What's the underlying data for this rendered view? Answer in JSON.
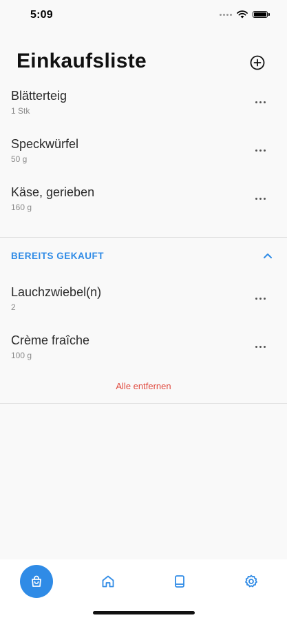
{
  "status_bar": {
    "time": "5:09",
    "icons": [
      "cellular-signal-icon",
      "wifi-icon",
      "battery-icon"
    ]
  },
  "header": {
    "title": "Einkaufsliste",
    "add_icon": "plus-circle-icon"
  },
  "shopping_list": [
    {
      "name": "Blätterteig",
      "quantity": "1 Stk"
    },
    {
      "name": "Speckwürfel",
      "quantity": "50 g"
    },
    {
      "name": "Käse, gerieben",
      "quantity": "160 g"
    }
  ],
  "purchased_section": {
    "title": "BEREITS GEKAUFT",
    "collapse_icon": "chevron-up-icon",
    "items": [
      {
        "name": "Lauchzwiebel(n)",
        "quantity": "2"
      },
      {
        "name": "Crème fraîche",
        "quantity": "100 g"
      }
    ],
    "remove_all_label": "Alle entfernen"
  },
  "tab_bar": {
    "tabs": [
      {
        "icon": "shopping-bag-icon",
        "active": true
      },
      {
        "icon": "home-icon",
        "active": false
      },
      {
        "icon": "book-icon",
        "active": false
      },
      {
        "icon": "gear-icon",
        "active": false
      }
    ]
  },
  "colors": {
    "accent": "#2f8be6",
    "danger": "#e04a3f",
    "background": "#f9f9f9",
    "tab_bar_background": "#ffffff"
  }
}
